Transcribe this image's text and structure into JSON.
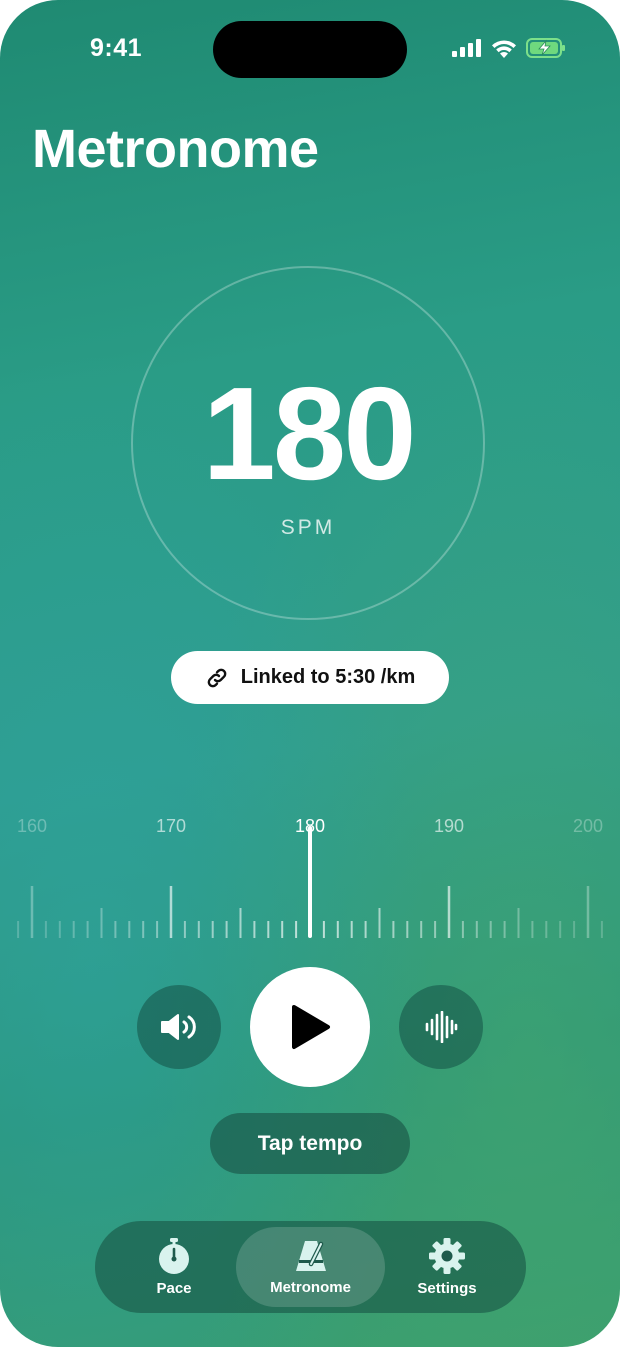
{
  "status": {
    "time": "9:41"
  },
  "title": "Metronome",
  "tempo": {
    "value": "180",
    "unit": "SPM"
  },
  "link": {
    "label": "Linked to 5:30 /km"
  },
  "ruler": {
    "labels": [
      "160",
      "170",
      "180",
      "190",
      "200"
    ],
    "selected": 180
  },
  "controls": {
    "tap_label": "Tap tempo"
  },
  "tabs": [
    {
      "label": "Pace",
      "icon": "stopwatch-icon"
    },
    {
      "label": "Metronome",
      "icon": "metronome-icon"
    },
    {
      "label": "Settings",
      "icon": "gear-icon"
    }
  ],
  "colors": {
    "accent": "#2a9c86",
    "dark": "#1e5a4c"
  }
}
